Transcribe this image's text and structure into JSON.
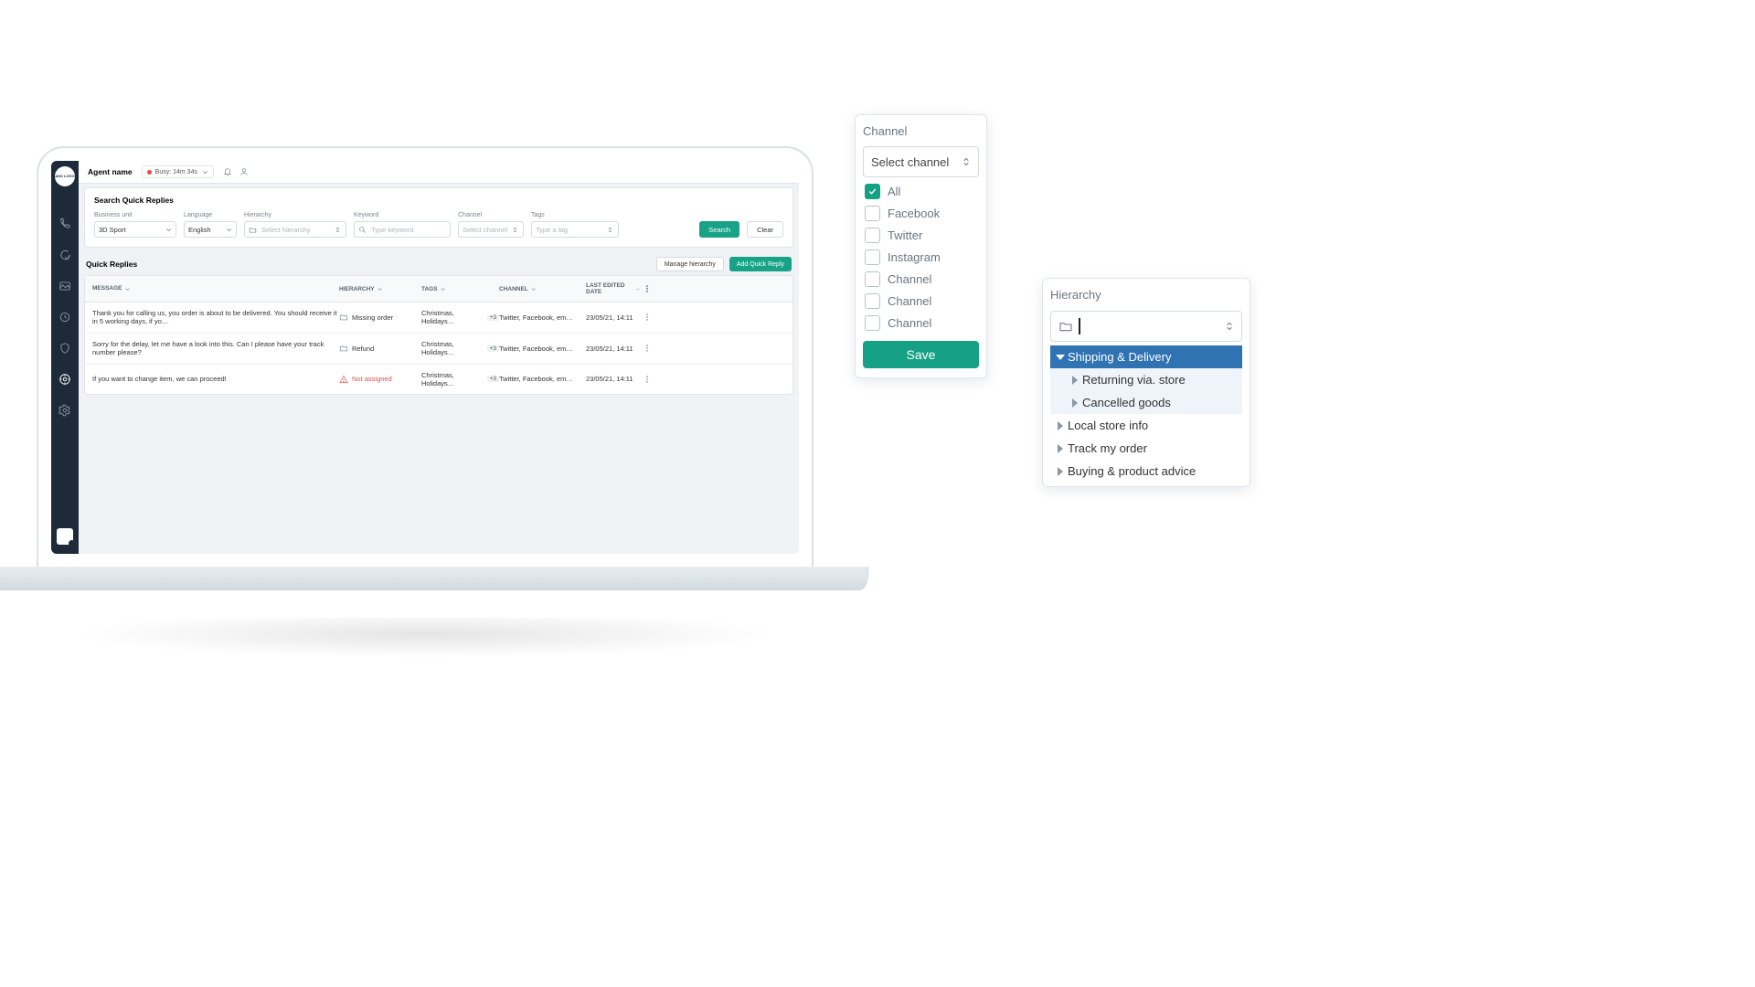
{
  "logo_text": "ADD LOGO",
  "topbar": {
    "agent_name_label": "Agent name",
    "status_text": "Busy: 14m 34s"
  },
  "search_card": {
    "title": "Search Quick Replies",
    "filters": {
      "business_unit": {
        "label": "Business unit",
        "value": "3D Sport"
      },
      "language": {
        "label": "Language",
        "value": "English"
      },
      "hierarchy": {
        "label": "Hierarchy",
        "placeholder": "Select hierarchy"
      },
      "keyword": {
        "label": "Keyword",
        "placeholder": "Type keyword"
      },
      "channel": {
        "label": "Channel",
        "placeholder": "Select channel"
      },
      "tags": {
        "label": "Tags",
        "placeholder": "Type a tag"
      }
    },
    "search_btn": "Search",
    "clear_btn": "Clear"
  },
  "replies_section": {
    "title": "Quick Replies",
    "manage_btn": "Manage hierarchy",
    "add_btn": "Add Quick Reply",
    "columns": {
      "message": "MESSAGE",
      "hierarchy": "HIERARCHY",
      "tags": "TAGS",
      "channel": "CHANNEL",
      "last_edited": "LAST EDITED DATE"
    },
    "rows": [
      {
        "message": "Thank you for calling us, you order is about to be delivered. You should receive it in 5 working days, if yo…",
        "hierarchy_label": "Missing order",
        "hierarchy_assigned": true,
        "tags_text": "Christmas, Holidays…",
        "tags_more": "+3",
        "channel": "Twitter, Facebook, em…",
        "edited": "23/05/21, 14:11"
      },
      {
        "message": "Sorry for the delay, let me have a look into this. Can I please have your track number please?",
        "hierarchy_label": "Refund",
        "hierarchy_assigned": true,
        "tags_text": "Christmas, Holidays…",
        "tags_more": "+3",
        "channel": "Twitter, Facebook, em…",
        "edited": "23/05/21, 14:11"
      },
      {
        "message": "If you want to change item, we can proceed!",
        "hierarchy_label": "Not assigned",
        "hierarchy_assigned": false,
        "tags_text": "Christmas, Holidays…",
        "tags_more": "+3",
        "channel": "Twitter, Facebook, em…",
        "edited": "23/05/21, 14:11"
      }
    ]
  },
  "channel_popup": {
    "title": "Channel",
    "select_label": "Select channel",
    "items": [
      {
        "label": "All",
        "checked": true
      },
      {
        "label": "Facebook",
        "checked": false
      },
      {
        "label": "Twitter",
        "checked": false
      },
      {
        "label": "Instagram",
        "checked": false
      },
      {
        "label": "Channel",
        "checked": false
      },
      {
        "label": "Channel",
        "checked": false
      },
      {
        "label": "Channel",
        "checked": false
      }
    ],
    "save_btn": "Save"
  },
  "hierarchy_popup": {
    "title": "Hierarchy",
    "tree": [
      {
        "label": "Shipping & Delivery",
        "level": 0,
        "selected": true,
        "expanded": true
      },
      {
        "label": "Returning via. store",
        "level": 1,
        "sub_hl": true
      },
      {
        "label": "Cancelled goods",
        "level": 1,
        "sub_hl": true
      },
      {
        "label": "Local store info",
        "level": 0
      },
      {
        "label": "Track my order",
        "level": 0
      },
      {
        "label": "Buying & product advice",
        "level": 0
      }
    ]
  },
  "stray_char": "$"
}
